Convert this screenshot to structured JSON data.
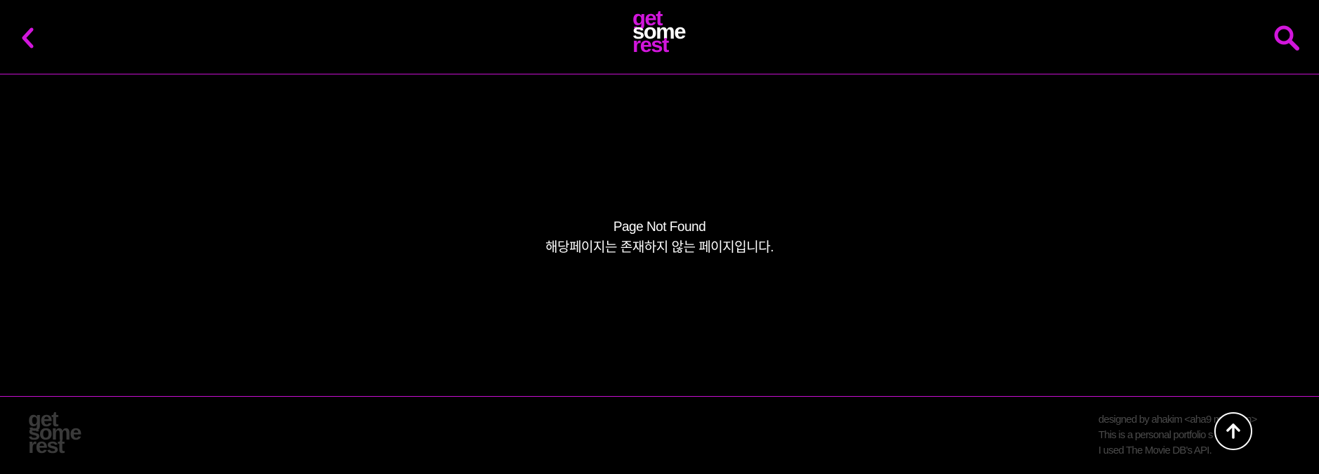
{
  "header": {
    "logo": [
      "get",
      "some",
      "rest"
    ],
    "back_icon": "chevron-left-icon",
    "search_icon": "search-icon"
  },
  "main": {
    "title": "Page Not Found",
    "subtitle": "해당페이지는 존재하지 않는 페이지입니다."
  },
  "footer": {
    "logo": [
      "get",
      "some",
      "rest"
    ],
    "info": [
      "designed by ahakim <aha9  mail.com>",
      "This is a personal portfolio s",
      "I used The Movie DB's API."
    ],
    "top_icon": "arrow-up-icon"
  },
  "colors": {
    "accent": "#d216dc",
    "background": "#000000",
    "footer_text": "#4a4a4a"
  }
}
